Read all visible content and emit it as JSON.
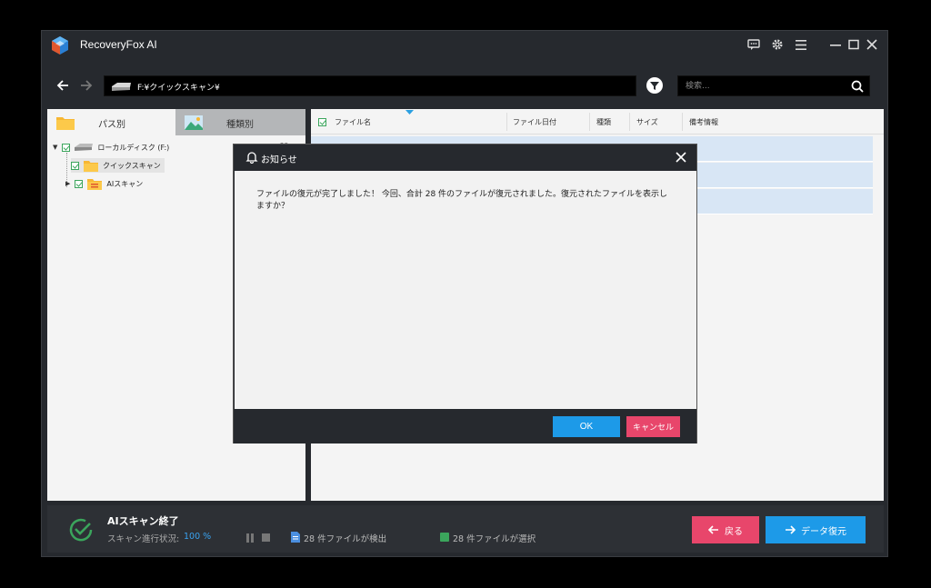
{
  "app": {
    "title": "RecoveryFox AI"
  },
  "address": {
    "path": "F:¥クイックスキャン¥",
    "search_placeholder": "検索..."
  },
  "left_panel": {
    "tabs": [
      {
        "label": "パス別"
      },
      {
        "label": "種類別"
      }
    ],
    "tree": [
      {
        "label": "ローカルディスク (F:)",
        "count": "28"
      },
      {
        "label": "クイックスキャン"
      },
      {
        "label": "AIスキャン"
      }
    ]
  },
  "file_list": {
    "columns": [
      "ファイル名",
      "ファイル日付",
      "種類",
      "サイズ",
      "備考情報"
    ]
  },
  "dialog": {
    "title": "お知らせ",
    "message": "ファイルの復元が完了しました！ 今回、合計 28 件のファイルが復元されました。復元されたファイルを表示しますか？",
    "ok_label": "OK",
    "cancel_label": "キャンセル"
  },
  "status": {
    "title": "AIスキャン終了",
    "progress_label": "スキャン進行状況:",
    "progress_value": "100 %",
    "found": "28 件ファイルが検出",
    "selected": "28 件ファイルが選択",
    "back_label": "戻る",
    "recover_label": "データ復元"
  },
  "colors": {
    "accent_blue": "#1d9ae8",
    "accent_red": "#e8466b",
    "success_green": "#3ba55c"
  }
}
